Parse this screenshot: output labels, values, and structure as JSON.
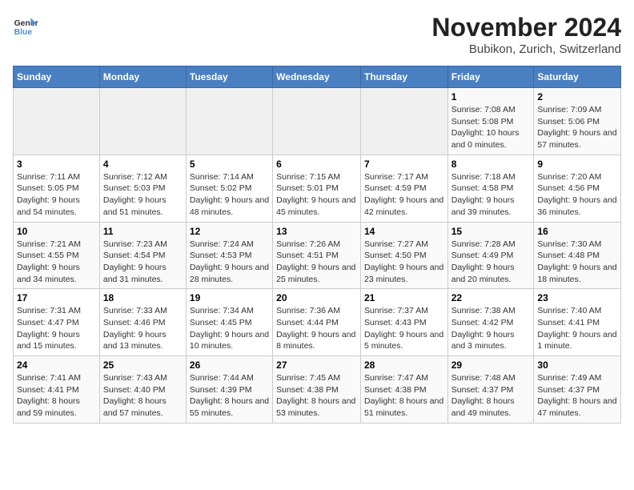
{
  "header": {
    "logo_line1": "General",
    "logo_line2": "Blue",
    "month": "November 2024",
    "location": "Bubikon, Zurich, Switzerland"
  },
  "weekdays": [
    "Sunday",
    "Monday",
    "Tuesday",
    "Wednesday",
    "Thursday",
    "Friday",
    "Saturday"
  ],
  "weeks": [
    [
      {
        "day": "",
        "info": ""
      },
      {
        "day": "",
        "info": ""
      },
      {
        "day": "",
        "info": ""
      },
      {
        "day": "",
        "info": ""
      },
      {
        "day": "",
        "info": ""
      },
      {
        "day": "1",
        "info": "Sunrise: 7:08 AM\nSunset: 5:08 PM\nDaylight: 10 hours and 0 minutes."
      },
      {
        "day": "2",
        "info": "Sunrise: 7:09 AM\nSunset: 5:06 PM\nDaylight: 9 hours and 57 minutes."
      }
    ],
    [
      {
        "day": "3",
        "info": "Sunrise: 7:11 AM\nSunset: 5:05 PM\nDaylight: 9 hours and 54 minutes."
      },
      {
        "day": "4",
        "info": "Sunrise: 7:12 AM\nSunset: 5:03 PM\nDaylight: 9 hours and 51 minutes."
      },
      {
        "day": "5",
        "info": "Sunrise: 7:14 AM\nSunset: 5:02 PM\nDaylight: 9 hours and 48 minutes."
      },
      {
        "day": "6",
        "info": "Sunrise: 7:15 AM\nSunset: 5:01 PM\nDaylight: 9 hours and 45 minutes."
      },
      {
        "day": "7",
        "info": "Sunrise: 7:17 AM\nSunset: 4:59 PM\nDaylight: 9 hours and 42 minutes."
      },
      {
        "day": "8",
        "info": "Sunrise: 7:18 AM\nSunset: 4:58 PM\nDaylight: 9 hours and 39 minutes."
      },
      {
        "day": "9",
        "info": "Sunrise: 7:20 AM\nSunset: 4:56 PM\nDaylight: 9 hours and 36 minutes."
      }
    ],
    [
      {
        "day": "10",
        "info": "Sunrise: 7:21 AM\nSunset: 4:55 PM\nDaylight: 9 hours and 34 minutes."
      },
      {
        "day": "11",
        "info": "Sunrise: 7:23 AM\nSunset: 4:54 PM\nDaylight: 9 hours and 31 minutes."
      },
      {
        "day": "12",
        "info": "Sunrise: 7:24 AM\nSunset: 4:53 PM\nDaylight: 9 hours and 28 minutes."
      },
      {
        "day": "13",
        "info": "Sunrise: 7:26 AM\nSunset: 4:51 PM\nDaylight: 9 hours and 25 minutes."
      },
      {
        "day": "14",
        "info": "Sunrise: 7:27 AM\nSunset: 4:50 PM\nDaylight: 9 hours and 23 minutes."
      },
      {
        "day": "15",
        "info": "Sunrise: 7:28 AM\nSunset: 4:49 PM\nDaylight: 9 hours and 20 minutes."
      },
      {
        "day": "16",
        "info": "Sunrise: 7:30 AM\nSunset: 4:48 PM\nDaylight: 9 hours and 18 minutes."
      }
    ],
    [
      {
        "day": "17",
        "info": "Sunrise: 7:31 AM\nSunset: 4:47 PM\nDaylight: 9 hours and 15 minutes."
      },
      {
        "day": "18",
        "info": "Sunrise: 7:33 AM\nSunset: 4:46 PM\nDaylight: 9 hours and 13 minutes."
      },
      {
        "day": "19",
        "info": "Sunrise: 7:34 AM\nSunset: 4:45 PM\nDaylight: 9 hours and 10 minutes."
      },
      {
        "day": "20",
        "info": "Sunrise: 7:36 AM\nSunset: 4:44 PM\nDaylight: 9 hours and 8 minutes."
      },
      {
        "day": "21",
        "info": "Sunrise: 7:37 AM\nSunset: 4:43 PM\nDaylight: 9 hours and 5 minutes."
      },
      {
        "day": "22",
        "info": "Sunrise: 7:38 AM\nSunset: 4:42 PM\nDaylight: 9 hours and 3 minutes."
      },
      {
        "day": "23",
        "info": "Sunrise: 7:40 AM\nSunset: 4:41 PM\nDaylight: 9 hours and 1 minute."
      }
    ],
    [
      {
        "day": "24",
        "info": "Sunrise: 7:41 AM\nSunset: 4:41 PM\nDaylight: 8 hours and 59 minutes."
      },
      {
        "day": "25",
        "info": "Sunrise: 7:43 AM\nSunset: 4:40 PM\nDaylight: 8 hours and 57 minutes."
      },
      {
        "day": "26",
        "info": "Sunrise: 7:44 AM\nSunset: 4:39 PM\nDaylight: 8 hours and 55 minutes."
      },
      {
        "day": "27",
        "info": "Sunrise: 7:45 AM\nSunset: 4:38 PM\nDaylight: 8 hours and 53 minutes."
      },
      {
        "day": "28",
        "info": "Sunrise: 7:47 AM\nSunset: 4:38 PM\nDaylight: 8 hours and 51 minutes."
      },
      {
        "day": "29",
        "info": "Sunrise: 7:48 AM\nSunset: 4:37 PM\nDaylight: 8 hours and 49 minutes."
      },
      {
        "day": "30",
        "info": "Sunrise: 7:49 AM\nSunset: 4:37 PM\nDaylight: 8 hours and 47 minutes."
      }
    ]
  ]
}
